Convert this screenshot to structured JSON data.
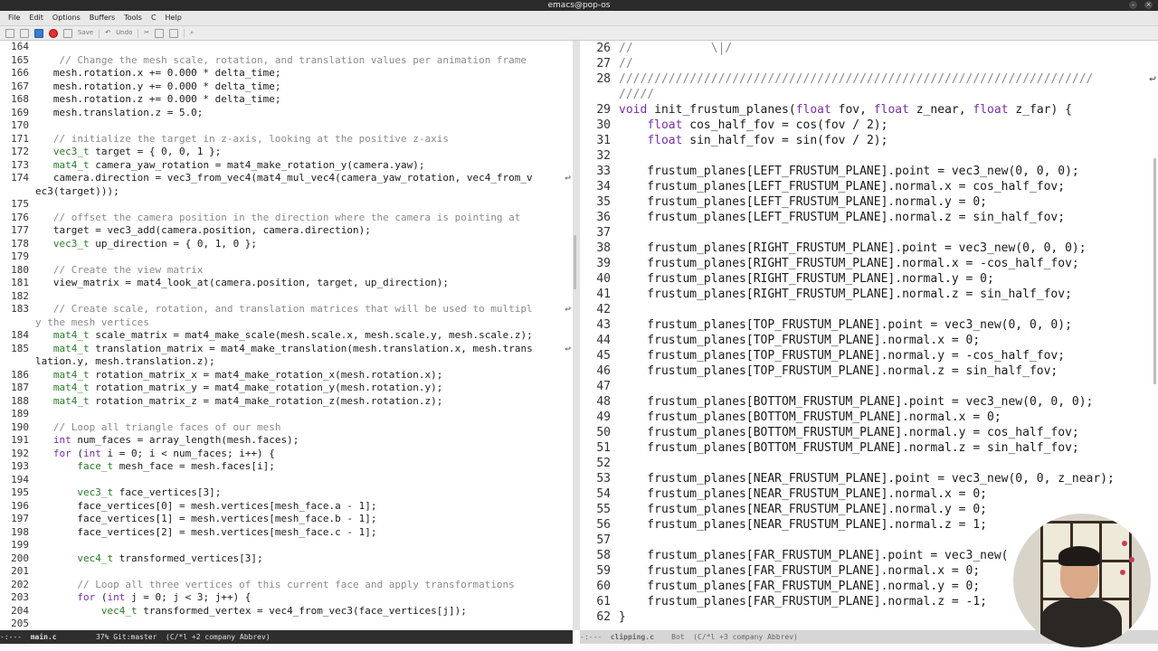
{
  "window": {
    "title": "emacs@pop-os"
  },
  "menu": [
    "File",
    "Edit",
    "Options",
    "Buffers",
    "Tools",
    "C",
    "Help"
  ],
  "toolbar": {
    "save_label": "Save",
    "undo_label": "Undo"
  },
  "left": {
    "lines": [
      {
        "n": "164",
        "t": ""
      },
      {
        "n": "165",
        "t": "    // Change the mesh scale, rotation, and translation values per animation frame",
        "k": "comment"
      },
      {
        "n": "166",
        "t": "   mesh.rotation.x += 0.000 * delta_time;"
      },
      {
        "n": "167",
        "t": "   mesh.rotation.y += 0.000 * delta_time;"
      },
      {
        "n": "168",
        "t": "   mesh.rotation.z += 0.000 * delta_time;"
      },
      {
        "n": "169",
        "t": "   mesh.translation.z = 5.0;"
      },
      {
        "n": "170",
        "t": ""
      },
      {
        "n": "171",
        "t": "   // initialize the target in z-axis, looking at the positive z-axis",
        "k": "comment"
      },
      {
        "n": "172",
        "t": "   vec3_t target = { 0, 0, 1 };"
      },
      {
        "n": "173",
        "t": "   mat4_t camera_yaw_rotation = mat4_make_rotation_y(camera.yaw);"
      },
      {
        "n": "174",
        "t": "   camera.direction = vec3_from_vec4(mat4_mul_vec4(camera_yaw_rotation, vec4_from_v",
        "w": true
      },
      {
        "n": "",
        "t": "ec3(target)));"
      },
      {
        "n": "175",
        "t": ""
      },
      {
        "n": "176",
        "t": "   // offset the camera position in the direction where the camera is pointing at",
        "k": "comment"
      },
      {
        "n": "177",
        "t": "   target = vec3_add(camera.position, camera.direction);"
      },
      {
        "n": "178",
        "t": "   vec3_t up_direction = { 0, 1, 0 };"
      },
      {
        "n": "179",
        "t": ""
      },
      {
        "n": "180",
        "t": "   // Create the view matrix",
        "k": "comment"
      },
      {
        "n": "181",
        "t": "   view_matrix = mat4_look_at(camera.position, target, up_direction);"
      },
      {
        "n": "182",
        "t": ""
      },
      {
        "n": "183",
        "t": "   // Create scale, rotation, and translation matrices that will be used to multipl",
        "k": "comment",
        "w": true
      },
      {
        "n": "",
        "t": "y the mesh vertices",
        "k": "comment"
      },
      {
        "n": "184",
        "t": "   mat4_t scale_matrix = mat4_make_scale(mesh.scale.x, mesh.scale.y, mesh.scale.z);"
      },
      {
        "n": "185",
        "t": "   mat4_t translation_matrix = mat4_make_translation(mesh.translation.x, mesh.trans",
        "w": true
      },
      {
        "n": "",
        "t": "lation.y, mesh.translation.z);"
      },
      {
        "n": "186",
        "t": "   mat4_t rotation_matrix_x = mat4_make_rotation_x(mesh.rotation.x);"
      },
      {
        "n": "187",
        "t": "   mat4_t rotation_matrix_y = mat4_make_rotation_y(mesh.rotation.y);"
      },
      {
        "n": "188",
        "t": "   mat4_t rotation_matrix_z = mat4_make_rotation_z(mesh.rotation.z);"
      },
      {
        "n": "189",
        "t": ""
      },
      {
        "n": "190",
        "t": "   // Loop all triangle faces of our mesh",
        "k": "comment"
      },
      {
        "n": "191",
        "t": "   int num_faces = array_length(mesh.faces);"
      },
      {
        "n": "192",
        "t": "   for (int i = 0; i < num_faces; i++) {"
      },
      {
        "n": "193",
        "t": "       face_t mesh_face = mesh.faces[i];"
      },
      {
        "n": "194",
        "t": ""
      },
      {
        "n": "195",
        "t": "       vec3_t face_vertices[3];"
      },
      {
        "n": "196",
        "t": "       face_vertices[0] = mesh.vertices[mesh_face.a - 1];"
      },
      {
        "n": "197",
        "t": "       face_vertices[1] = mesh.vertices[mesh_face.b - 1];"
      },
      {
        "n": "198",
        "t": "       face_vertices[2] = mesh.vertices[mesh_face.c - 1];"
      },
      {
        "n": "199",
        "t": ""
      },
      {
        "n": "200",
        "t": "       vec4_t transformed_vertices[3];"
      },
      {
        "n": "201",
        "t": ""
      },
      {
        "n": "202",
        "t": "       // Loop all three vertices of this current face and apply transformations",
        "k": "comment"
      },
      {
        "n": "203",
        "t": "       for (int j = 0; j < 3; j++) {"
      },
      {
        "n": "204",
        "t": "           vec4_t transformed_vertex = vec4_from_vec3(face_vertices[j]);"
      },
      {
        "n": "205",
        "t": ""
      }
    ]
  },
  "right": {
    "lines": [
      {
        "n": "26",
        "t": "//           \\|/",
        "k": "comment"
      },
      {
        "n": "27",
        "t": "//",
        "k": "comment"
      },
      {
        "n": "28",
        "t": "///////////////////////////////////////////////////////////////////",
        "k": "comment",
        "w": true
      },
      {
        "n": "",
        "t": "/////",
        "k": "comment"
      },
      {
        "n": "29",
        "t": "void init_frustum_planes(float fov, float z_near, float z_far) {"
      },
      {
        "n": "30",
        "t": "    float cos_half_fov = cos(fov / 2);"
      },
      {
        "n": "31",
        "t": "    float sin_half_fov = sin(fov / 2);"
      },
      {
        "n": "32",
        "t": ""
      },
      {
        "n": "33",
        "t": "    frustum_planes[LEFT_FRUSTUM_PLANE].point = vec3_new(0, 0, 0);"
      },
      {
        "n": "34",
        "t": "    frustum_planes[LEFT_FRUSTUM_PLANE].normal.x = cos_half_fov;"
      },
      {
        "n": "35",
        "t": "    frustum_planes[LEFT_FRUSTUM_PLANE].normal.y = 0;"
      },
      {
        "n": "36",
        "t": "    frustum_planes[LEFT_FRUSTUM_PLANE].normal.z = sin_half_fov;"
      },
      {
        "n": "37",
        "t": ""
      },
      {
        "n": "38",
        "t": "    frustum_planes[RIGHT_FRUSTUM_PLANE].point = vec3_new(0, 0, 0);"
      },
      {
        "n": "39",
        "t": "    frustum_planes[RIGHT_FRUSTUM_PLANE].normal.x = -cos_half_fov;"
      },
      {
        "n": "40",
        "t": "    frustum_planes[RIGHT_FRUSTUM_PLANE].normal.y = 0;"
      },
      {
        "n": "41",
        "t": "    frustum_planes[RIGHT_FRUSTUM_PLANE].normal.z = sin_half_fov;"
      },
      {
        "n": "42",
        "t": ""
      },
      {
        "n": "43",
        "t": "    frustum_planes[TOP_FRUSTUM_PLANE].point = vec3_new(0, 0, 0);"
      },
      {
        "n": "44",
        "t": "    frustum_planes[TOP_FRUSTUM_PLANE].normal.x = 0;"
      },
      {
        "n": "45",
        "t": "    frustum_planes[TOP_FRUSTUM_PLANE].normal.y = -cos_half_fov;"
      },
      {
        "n": "46",
        "t": "    frustum_planes[TOP_FRUSTUM_PLANE].normal.z = sin_half_fov;"
      },
      {
        "n": "47",
        "t": ""
      },
      {
        "n": "48",
        "t": "    frustum_planes[BOTTOM_FRUSTUM_PLANE].point = vec3_new(0, 0, 0);"
      },
      {
        "n": "49",
        "t": "    frustum_planes[BOTTOM_FRUSTUM_PLANE].normal.x = 0;"
      },
      {
        "n": "50",
        "t": "    frustum_planes[BOTTOM_FRUSTUM_PLANE].normal.y = cos_half_fov;"
      },
      {
        "n": "51",
        "t": "    frustum_planes[BOTTOM_FRUSTUM_PLANE].normal.z = sin_half_fov;"
      },
      {
        "n": "52",
        "t": ""
      },
      {
        "n": "53",
        "t": "    frustum_planes[NEAR_FRUSTUM_PLANE].point = vec3_new(0, 0, z_near);"
      },
      {
        "n": "54",
        "t": "    frustum_planes[NEAR_FRUSTUM_PLANE].normal.x = 0;"
      },
      {
        "n": "55",
        "t": "    frustum_planes[NEAR_FRUSTUM_PLANE].normal.y = 0;"
      },
      {
        "n": "56",
        "t": "    frustum_planes[NEAR_FRUSTUM_PLANE].normal.z = 1;"
      },
      {
        "n": "57",
        "t": ""
      },
      {
        "n": "58",
        "t": "    frustum_planes[FAR_FRUSTUM_PLANE].point = vec3_new("
      },
      {
        "n": "59",
        "t": "    frustum_planes[FAR_FRUSTUM_PLANE].normal.x = 0;"
      },
      {
        "n": "60",
        "t": "    frustum_planes[FAR_FRUSTUM_PLANE].normal.y = 0;"
      },
      {
        "n": "61",
        "t": "    frustum_planes[FAR_FRUSTUM_PLANE].normal.z = -1;"
      },
      {
        "n": "62",
        "t": "}"
      }
    ]
  },
  "modeline_left": {
    "prefix": "-:---  ",
    "filename": "main.c",
    "info": "         37% Git:master  (C/*l +2 company Abbrev)"
  },
  "modeline_right": {
    "prefix": "-:---  ",
    "filename": "clipping.c",
    "info": "    Bot  (C/*l +3 company Abbrev)"
  },
  "colors": {
    "comment": "#8a8a8a",
    "keyword": "#7a2fa3",
    "type": "#2a7a2a"
  }
}
